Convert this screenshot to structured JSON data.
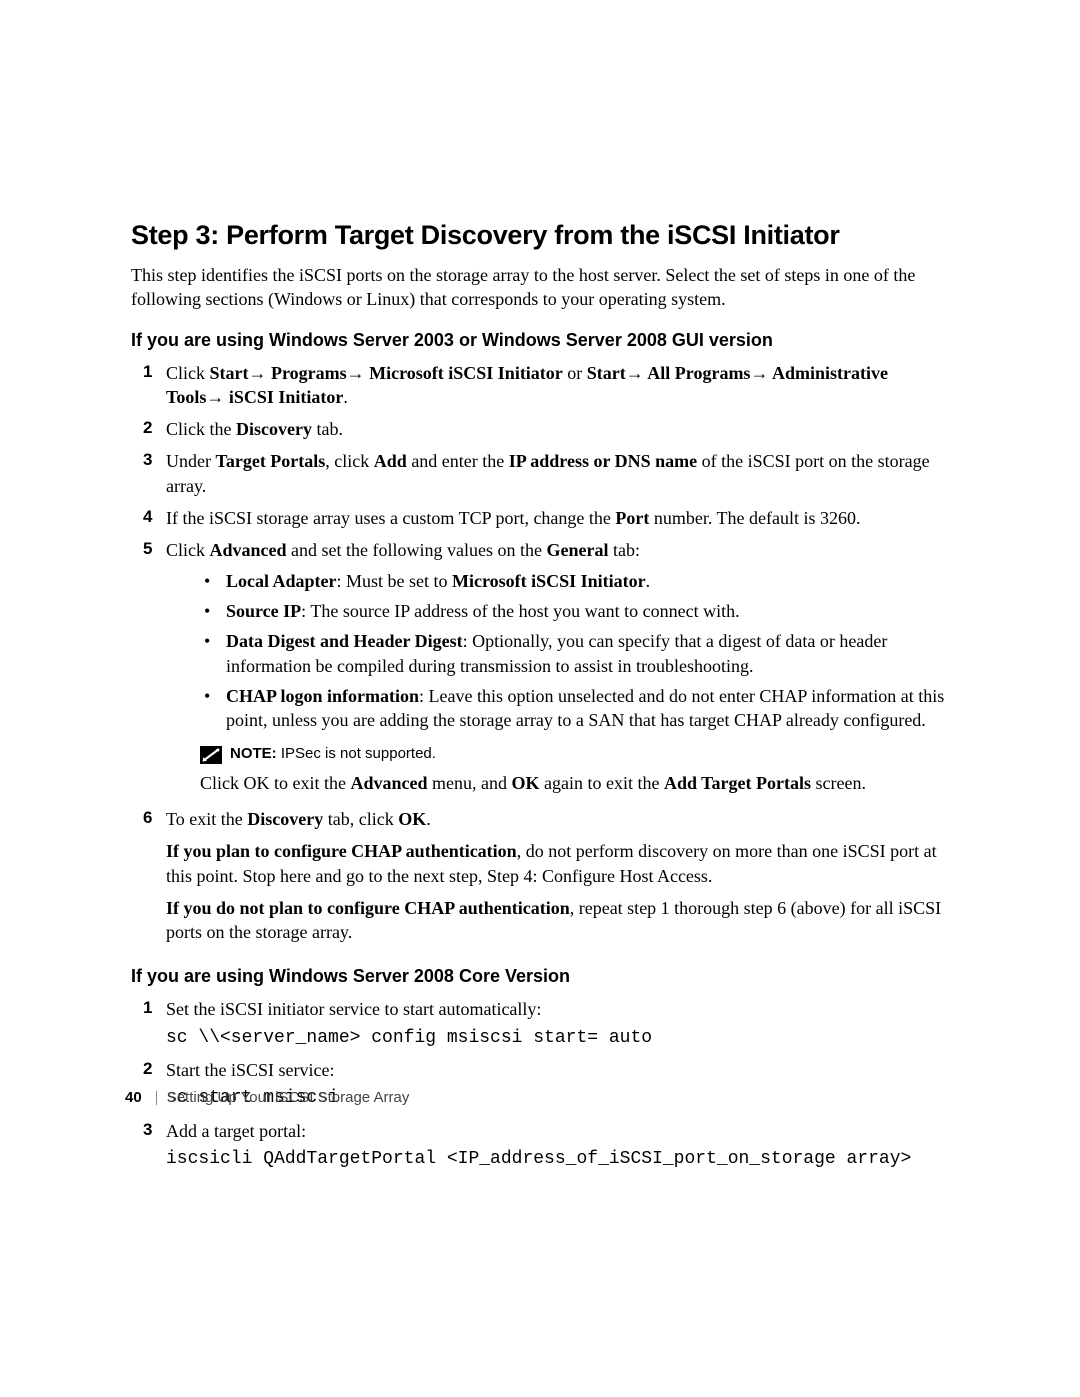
{
  "heading": "Step 3: Perform Target Discovery from the iSCSI Initiator",
  "intro": "This step identifies the iSCSI ports on the storage array to the host server. Select the set of steps in one of the following sections (Windows or Linux) that corresponds to your operating system.",
  "sectionA": {
    "title": "If you are using Windows Server 2003 or Windows Server 2008 GUI version",
    "steps": {
      "s1": "Click Start→ Programs→ Microsoft iSCSI Initiator or Start→ All Programs→ Administrative Tools→ iSCSI Initiator.",
      "s2": "Click the Discovery tab.",
      "s3": "Under Target Portals, click Add and enter the IP address or DNS name of the iSCSI port on the storage array.",
      "s4": "If the iSCSI storage array uses a custom TCP port, change the Port number. The default is 3260.",
      "s5": "Click Advanced and set the following values on the General tab:",
      "s5_bullets": {
        "b1": "Local Adapter: Must be set to Microsoft iSCSI Initiator.",
        "b2": "Source IP: The source IP address of the host you want to connect with.",
        "b3": "Data Digest and Header Digest: Optionally, you can specify that a digest of data or header information be compiled during transmission to assist in troubleshooting.",
        "b4": "CHAP logon information: Leave this option unselected and do not enter CHAP information at this point, unless you are adding the storage array to a SAN that has target CHAP already configured."
      },
      "note": "NOTE: IPSec is not supported.",
      "s5_after": "Click OK to exit the Advanced menu, and OK again to exit the Add Target Portals screen.",
      "s6": "To exit the Discovery tab, click OK.",
      "s6_p1": "If you plan to configure CHAP authentication, do not perform discovery on more than one iSCSI port at this point. Stop here and go to the next step, Step 4: Configure Host Access.",
      "s6_p2": "If you do not plan to configure CHAP authentication, repeat step 1 thorough step 6 (above) for all iSCSI ports on the storage array."
    }
  },
  "sectionB": {
    "title": "If you are using Windows Server 2008 Core Version",
    "steps": {
      "s1": "Set the iSCSI initiator service to start automatically:",
      "s1_cmd": "sc \\\\<server_name> config msiscsi start= auto",
      "s2": "Start the iSCSI service:",
      "s2_cmd": "sc start msiscsi",
      "s3": "Add a target portal:",
      "s3_cmd": "iscsicli QAddTargetPortal <IP_address_of_iSCSI_port_on_storage array>"
    }
  },
  "footer": {
    "page": "40",
    "title": "Setting Up Your iSCSI Storage Array"
  }
}
